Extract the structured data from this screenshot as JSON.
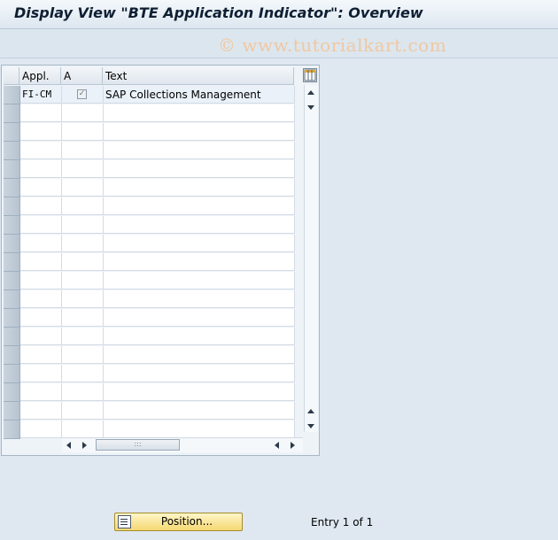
{
  "window": {
    "title": "Display View \"BTE Application Indicator\": Overview"
  },
  "watermark": {
    "text": "© www.tutorialkart.com"
  },
  "table": {
    "columns": [
      "Appl.",
      "A",
      "Text"
    ],
    "rows": [
      {
        "appl": "FI-CM",
        "active": true,
        "text": "SAP Collections Management"
      }
    ],
    "empty_rows": 18
  },
  "footer": {
    "position_button": "Position...",
    "entry_text": "Entry 1 of 1"
  },
  "colors": {
    "accent": "#f5d873",
    "header_text": "#0f1f33"
  },
  "icons": {
    "column_config": "table-settings-icon",
    "position": "position-icon",
    "checkbox": "checkbox-checked-icon"
  }
}
